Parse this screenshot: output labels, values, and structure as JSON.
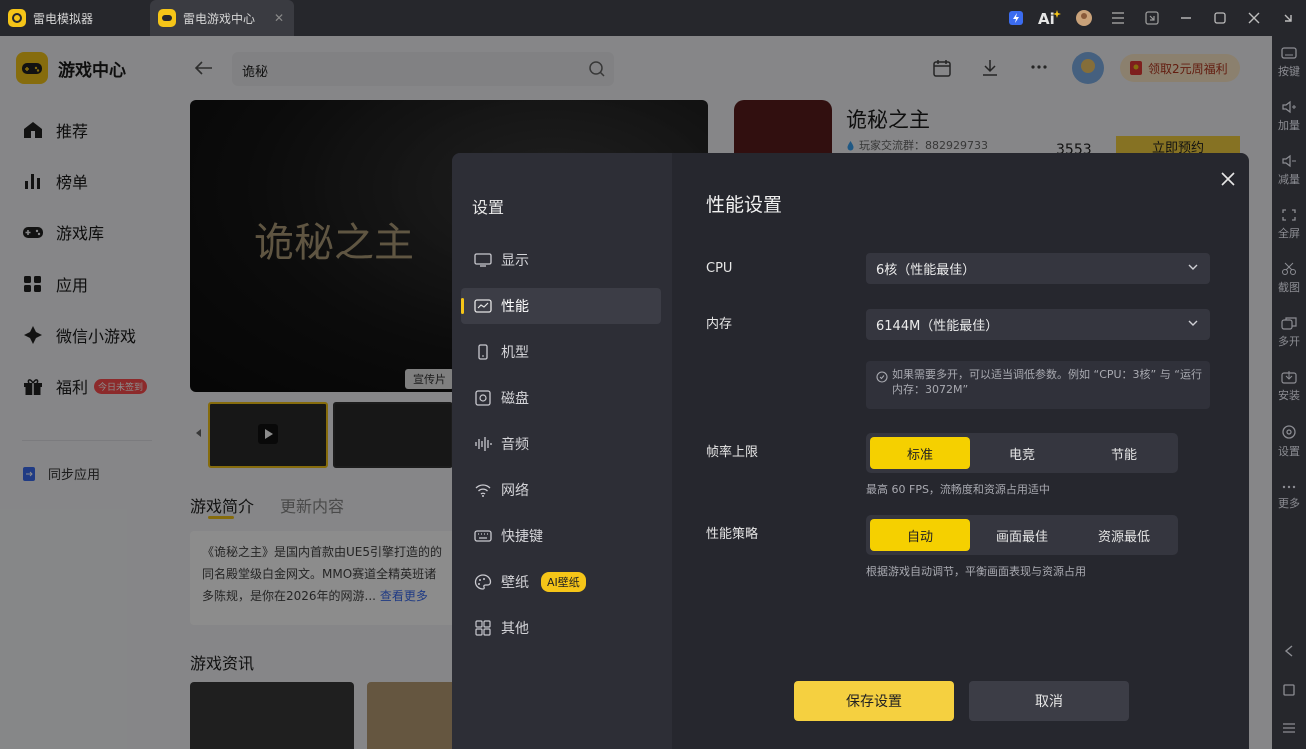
{
  "titlebar": {
    "tabs": [
      {
        "label": "雷电模拟器"
      },
      {
        "label": "雷电游戏中心"
      }
    ]
  },
  "right_toolbar": [
    "按键",
    "加量",
    "减量",
    "全屏",
    "截图",
    "多开",
    "安装",
    "设置",
    "更多"
  ],
  "sidebar": {
    "brand": "游戏中心",
    "items": [
      {
        "label": "推荐"
      },
      {
        "label": "榜单"
      },
      {
        "label": "游戏库"
      },
      {
        "label": "应用"
      },
      {
        "label": "微信小游戏"
      },
      {
        "label": "福利",
        "badge": "今日未签到"
      }
    ],
    "sync": "同步应用"
  },
  "main": {
    "search_value": "诡秘",
    "promo": "领取2元周福利",
    "banner_title": "诡秘之主",
    "banner_label": "宣传片",
    "game_title": "诡秘之主",
    "group": "玩家交流群：882929733",
    "count": "3553",
    "reserve": "立即预约",
    "tabs": [
      "游戏简介",
      "更新内容"
    ],
    "intro": "《诡秘之主》是国内首款由UE5引擎打造的的同名殿堂级白金网文。MMO赛道全精英班诸多陈规，是你在2026年的网游...",
    "intro_more": "查看更多",
    "news_heading": "游戏资讯"
  },
  "dialog": {
    "sidebar_title": "设置",
    "menu": [
      {
        "label": "显示"
      },
      {
        "label": "性能"
      },
      {
        "label": "机型"
      },
      {
        "label": "磁盘"
      },
      {
        "label": "音频"
      },
      {
        "label": "网络"
      },
      {
        "label": "快捷键"
      },
      {
        "label": "壁纸",
        "badge": "AI壁纸"
      },
      {
        "label": "其他"
      }
    ],
    "title": "性能设置",
    "cpu": {
      "label": "CPU",
      "value": "6核（性能最佳）"
    },
    "memory": {
      "label": "内存",
      "value": "6144M（性能最佳）"
    },
    "tip": "如果需要多开，可以适当调低参数。例如 “CPU：3核” 与 “运行内存：3072M”",
    "framerate": {
      "label": "帧率上限",
      "options": [
        "标准",
        "电竞",
        "节能"
      ],
      "note": "最高 60 FPS，流畅度和资源占用适中"
    },
    "strategy": {
      "label": "性能策略",
      "options": [
        "自动",
        "画面最佳",
        "资源最低"
      ],
      "note": "根据游戏自动调节，平衡画面表现与资源占用"
    },
    "save": "保存设置",
    "cancel": "取消"
  }
}
